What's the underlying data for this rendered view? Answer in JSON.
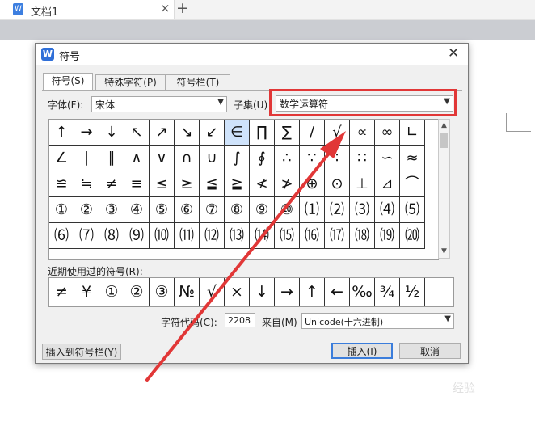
{
  "app": {
    "doc_tab_title": "文档1",
    "doc_icon_text": "W",
    "tab_close_glyph": "×",
    "new_tab_glyph": "+"
  },
  "dialog": {
    "title": "符号",
    "close_glyph": "✕",
    "icon_text": "W",
    "tabs": [
      {
        "label": "符号(S)",
        "active": true
      },
      {
        "label": "特殊字符(P)",
        "active": false
      },
      {
        "label": "符号栏(T)",
        "active": false
      }
    ],
    "font_label": "字体(F):",
    "font_value": "宋体",
    "subset_label": "子集(U)",
    "subset_value": "数学运算符",
    "highlight_color": "#e13737",
    "grid": [
      [
        "↑",
        "→",
        "↓",
        "↖",
        "↗",
        "↘",
        "↙",
        "∈",
        "∏",
        "∑",
        "/",
        "√",
        "∝",
        "∞",
        "∟"
      ],
      [
        "∠",
        "∣",
        "∥",
        "∧",
        "∨",
        "∩",
        "∪",
        "∫",
        "∮",
        "∴",
        "∵",
        "∶",
        "∷",
        "∽",
        "≈"
      ],
      [
        "≌",
        "≒",
        "≠",
        "≡",
        "≤",
        "≥",
        "≦",
        "≧",
        "≮",
        "≯",
        "⊕",
        "⊙",
        "⊥",
        "⊿",
        "⌒"
      ],
      [
        "①",
        "②",
        "③",
        "④",
        "⑤",
        "⑥",
        "⑦",
        "⑧",
        "⑨",
        "⑩",
        "⑴",
        "⑵",
        "⑶",
        "⑷",
        "⑸"
      ],
      [
        "⑹",
        "⑺",
        "⑻",
        "⑼",
        "⑽",
        "⑾",
        "⑿",
        "⒀",
        "⒁",
        "⒂",
        "⒃",
        "⒄",
        "⒅",
        "⒆",
        "⒇"
      ]
    ],
    "selected_symbol": "∈",
    "recent_label": "近期使用过的符号(R):",
    "recent": [
      "≠",
      "¥",
      "①",
      "②",
      "③",
      "№",
      "√",
      "×",
      "↓",
      "→",
      "↑",
      "←",
      "‰",
      "¾",
      "½"
    ],
    "code_label": "字符代码(C):",
    "code_value": "2208",
    "from_label": "来自(M)",
    "from_value": "Unicode(十六进制)",
    "buttons": {
      "insert_to_bar": "插入到符号栏(Y)",
      "insert": "插入(I)",
      "cancel": "取消"
    }
  },
  "scrollbar": {
    "up": "▲",
    "down": "▼"
  },
  "dropdown_caret": "▼",
  "watermark": "经验"
}
